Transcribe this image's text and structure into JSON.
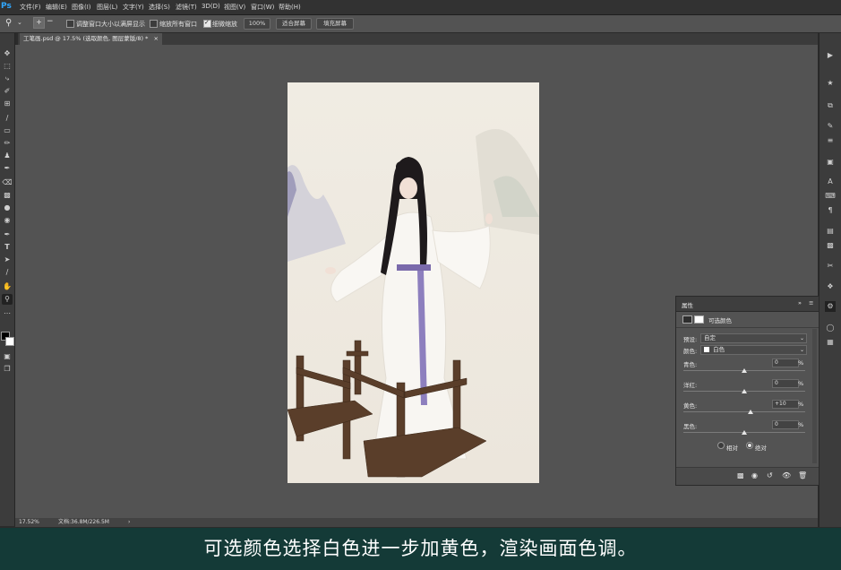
{
  "app": {
    "logo": "Ps"
  },
  "menu": {
    "items": [
      "文件(F)",
      "编辑(E)",
      "图像(I)",
      "图层(L)",
      "文字(Y)",
      "选择(S)",
      "滤镜(T)",
      "3D(D)",
      "视图(V)",
      "窗口(W)",
      "帮助(H)"
    ]
  },
  "options": {
    "resize_windows": "调整窗口大小以满屏显示",
    "zoom_all": "缩放所有窗口",
    "scrubby_zoom": "细微缩放",
    "zoom_value": "100%",
    "fit_screen": "适合屏幕",
    "fill_screen": "填充屏幕"
  },
  "document": {
    "tab_title": "工笔画.psd @ 17.5% (选取颜色, 图层蒙版/8) *",
    "close": "×"
  },
  "status": {
    "zoom": "17.52%",
    "doc_size": "文档:36.8M/226.5M",
    "arrow": "›"
  },
  "properties_panel": {
    "title": "属性",
    "subtitle": "可选颜色",
    "preset_label": "预设:",
    "preset_value": "自定",
    "colors_label": "颜色:",
    "colors_value": "白色",
    "sliders": [
      {
        "label": "青色:",
        "value": "0",
        "unit": "%",
        "level": 0
      },
      {
        "label": "洋红:",
        "value": "0",
        "unit": "%",
        "level": 0
      },
      {
        "label": "黄色:",
        "value": "+10",
        "unit": "%",
        "level": 10
      },
      {
        "label": "黑色:",
        "value": "0",
        "unit": "%",
        "level": 0
      }
    ],
    "relative": "相对",
    "absolute": "绝对"
  },
  "caption": "可选颜色选择白色进一步加黄色，渲染画面色调。",
  "colors": {
    "caption_bg": "#143a37",
    "accent": "#31a8ff"
  }
}
